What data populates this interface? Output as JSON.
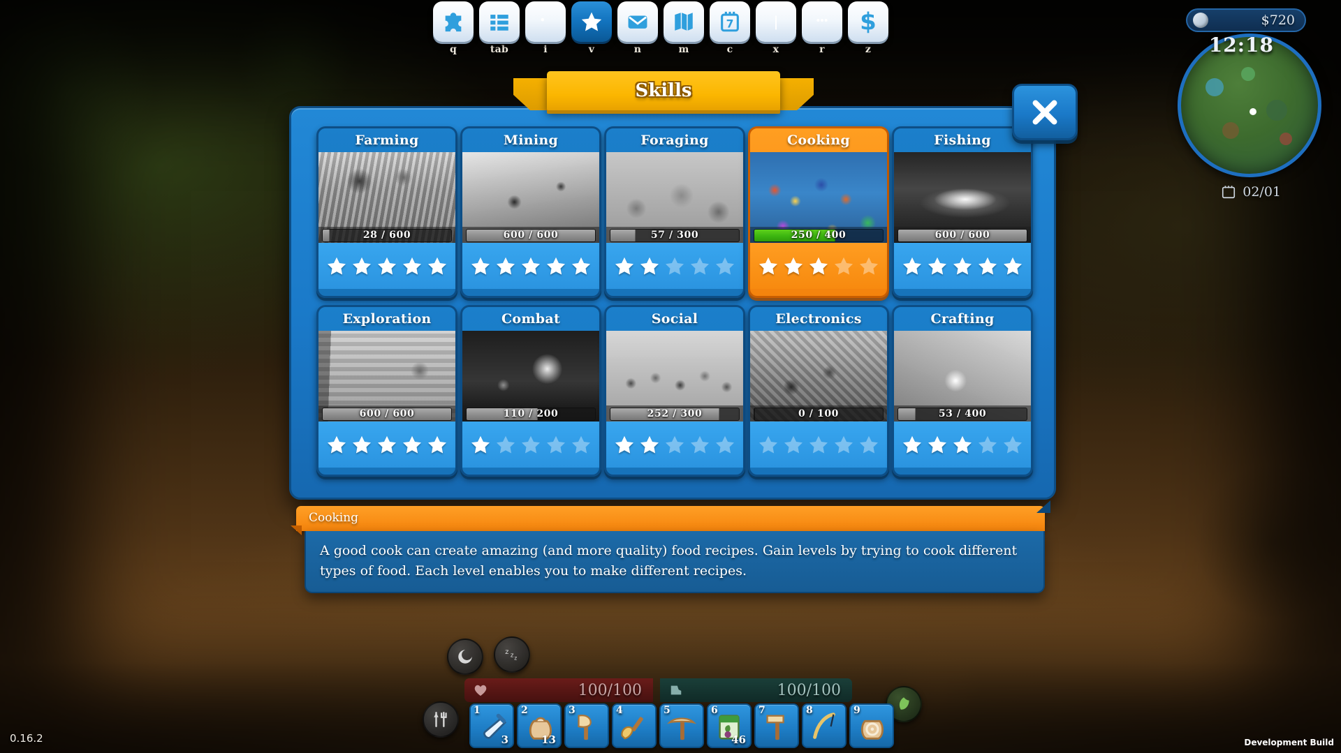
{
  "hud": {
    "money": "$720",
    "clock": "12:18",
    "date": "02/01",
    "money_icon": "coin-icon",
    "date_icon": "calendar-icon",
    "health": "100/100",
    "stamina": "100/100",
    "health_icon": "heart-icon",
    "stamina_icon": "boot-icon"
  },
  "topbar": {
    "items": [
      {
        "icon": "puzzle-icon",
        "key": "q",
        "active": false
      },
      {
        "icon": "list-icon",
        "key": "tab",
        "active": false
      },
      {
        "icon": "backpack-icon",
        "key": "i",
        "active": false
      },
      {
        "icon": "star-icon",
        "key": "v",
        "active": true
      },
      {
        "icon": "envelope-icon",
        "key": "n",
        "active": false
      },
      {
        "icon": "map-icon",
        "key": "m",
        "active": false
      },
      {
        "icon": "calendar-icon",
        "key": "c",
        "active": false
      },
      {
        "icon": "book-icon",
        "key": "x",
        "active": false
      },
      {
        "icon": "chat-icon",
        "key": "r",
        "active": false
      },
      {
        "icon": "dollar-icon",
        "key": "z",
        "active": false
      }
    ]
  },
  "window": {
    "title": "Skills",
    "close_icon": "close-icon"
  },
  "skills": [
    {
      "name": "Farming",
      "current": 28,
      "max": 600,
      "progress": "28 / 600",
      "stars_filled": 5,
      "stars_total": 5,
      "selected": false,
      "thumb": "th-farm"
    },
    {
      "name": "Mining",
      "current": 600,
      "max": 600,
      "progress": "600 / 600",
      "stars_filled": 5,
      "stars_total": 5,
      "selected": false,
      "thumb": "th-mine"
    },
    {
      "name": "Foraging",
      "current": 57,
      "max": 300,
      "progress": "57 / 300",
      "stars_filled": 2,
      "stars_total": 5,
      "selected": false,
      "thumb": "th-forage"
    },
    {
      "name": "Cooking",
      "current": 250,
      "max": 400,
      "progress": "250 / 400",
      "stars_filled": 3,
      "stars_total": 5,
      "selected": true,
      "thumb": "th-cook"
    },
    {
      "name": "Fishing",
      "current": 600,
      "max": 600,
      "progress": "600 / 600",
      "stars_filled": 5,
      "stars_total": 5,
      "selected": false,
      "thumb": "th-fish"
    },
    {
      "name": "Exploration",
      "current": 600,
      "max": 600,
      "progress": "600 / 600",
      "stars_filled": 5,
      "stars_total": 5,
      "selected": false,
      "thumb": "th-expl"
    },
    {
      "name": "Combat",
      "current": 110,
      "max": 200,
      "progress": "110 / 200",
      "stars_filled": 1,
      "stars_total": 5,
      "selected": false,
      "thumb": "th-combat"
    },
    {
      "name": "Social",
      "current": 252,
      "max": 300,
      "progress": "252 / 300",
      "stars_filled": 2,
      "stars_total": 5,
      "selected": false,
      "thumb": "th-social"
    },
    {
      "name": "Electronics",
      "current": 0,
      "max": 100,
      "progress": "0 / 100",
      "stars_filled": 0,
      "stars_total": 5,
      "selected": false,
      "thumb": "th-elec"
    },
    {
      "name": "Crafting",
      "current": 53,
      "max": 400,
      "progress": "53 / 400",
      "stars_filled": 3,
      "stars_total": 5,
      "selected": false,
      "thumb": "th-craft"
    }
  ],
  "description": {
    "title": "Cooking",
    "text": "A good cook can create amazing (and more quality) food recipes. Gain levels by trying to cook different types of food. Each level enables you to make different recipes."
  },
  "hotbar": [
    {
      "slot": "1",
      "icon": "bottle-icon",
      "qty": "3"
    },
    {
      "slot": "2",
      "icon": "sack-icon",
      "qty": "13"
    },
    {
      "slot": "3",
      "icon": "axe-icon",
      "qty": ""
    },
    {
      "slot": "4",
      "icon": "shovel-icon",
      "qty": ""
    },
    {
      "slot": "5",
      "icon": "pickaxe-icon",
      "qty": ""
    },
    {
      "slot": "6",
      "icon": "seed-bag-icon",
      "qty": "46"
    },
    {
      "slot": "7",
      "icon": "hammer-icon",
      "qty": ""
    },
    {
      "slot": "8",
      "icon": "fishing-rod-icon",
      "qty": ""
    },
    {
      "slot": "9",
      "icon": "flour-sack-icon",
      "qty": ""
    }
  ],
  "side_buttons": [
    {
      "icon": "sleep-icon"
    },
    {
      "icon": "zzz-icon"
    },
    {
      "icon": "tools-icon"
    },
    {
      "icon": "leaf-icon"
    }
  ],
  "footer": {
    "version": "0.16.2",
    "build": "Development Build"
  },
  "colors": {
    "panel_blue": "#1a79c8",
    "selected_orange": "#f5840c",
    "progress_green": "#3cb510",
    "banner_yellow": "#fbb600"
  }
}
